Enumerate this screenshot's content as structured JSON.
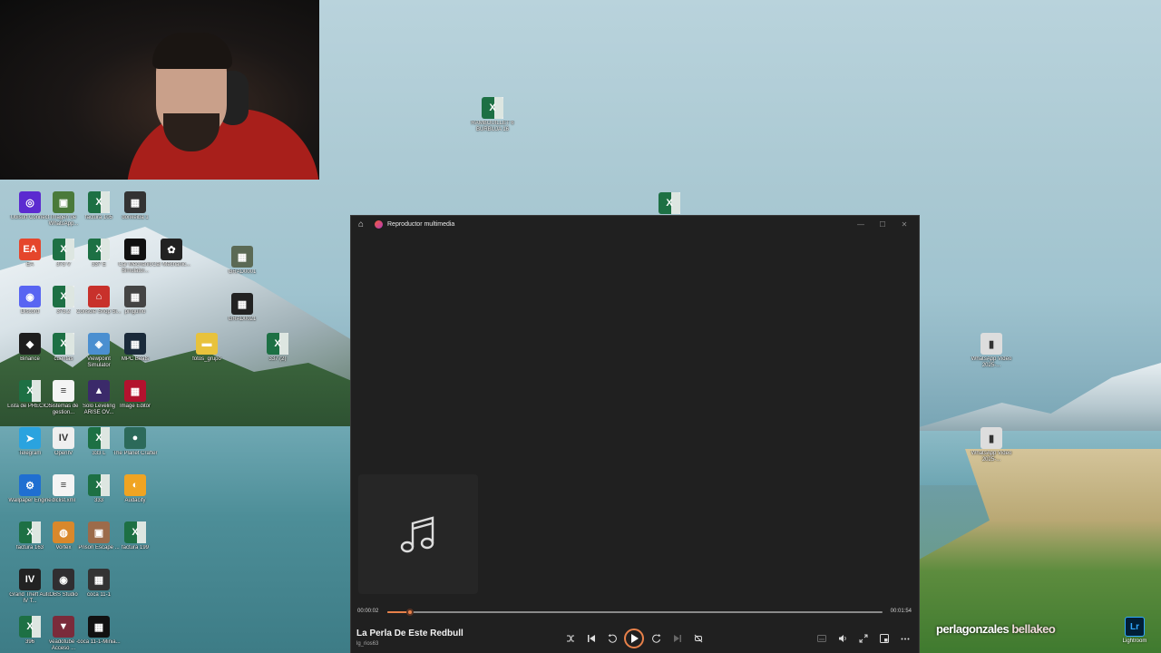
{
  "webcam": {
    "label": ""
  },
  "desktop": {
    "icons": [
      {
        "label": "Ubisoft Connect",
        "type": "app",
        "color": "#5b2bd0",
        "glyph": "◎"
      },
      {
        "label": "Imagen de WhatsApp...",
        "type": "img",
        "color": "#4a7a3a",
        "glyph": "▣"
      },
      {
        "label": "factura 105",
        "type": "xl"
      },
      {
        "label": "donkeiba 1",
        "type": "img",
        "color": "#333",
        "glyph": "▦"
      },
      {
        "label": "EA",
        "type": "app",
        "color": "#e5462c",
        "glyph": "EA"
      },
      {
        "label": "373 V",
        "type": "xl"
      },
      {
        "label": "337 E",
        "type": "xl"
      },
      {
        "label": "Car Mechanic Simulator...",
        "type": "img",
        "color": "#111",
        "glyph": "▦"
      },
      {
        "label": "Car Mechanic...",
        "type": "app",
        "color": "#222",
        "glyph": "✿"
      },
      {
        "label": "GRAD0001",
        "type": "img",
        "color": "#5b6a55",
        "glyph": "▦"
      },
      {
        "label": "Discord",
        "type": "app",
        "color": "#5865f2",
        "glyph": "◉"
      },
      {
        "label": "373.2",
        "type": "xl"
      },
      {
        "label": "Console Shop Si...",
        "type": "app",
        "color": "#c8312b",
        "glyph": "⌂"
      },
      {
        "label": "pinguino",
        "type": "img",
        "color": "#444",
        "glyph": "▦"
      },
      {
        "label": "GRAD0021",
        "type": "img",
        "color": "#222",
        "glyph": "▦"
      },
      {
        "label": "Binance",
        "type": "app",
        "color": "#1e1e1e",
        "glyph": "◆"
      },
      {
        "label": "cuentas",
        "type": "xl"
      },
      {
        "label": "Viewpoint Simulator",
        "type": "app",
        "color": "#4b8fd0",
        "glyph": "◈"
      },
      {
        "label": "MPC Beats",
        "type": "app",
        "color": "#1a2a3a",
        "glyph": "▦"
      },
      {
        "label": "fotos_grupo",
        "type": "folder",
        "color": "#e8c23c",
        "glyph": "▬"
      },
      {
        "label": "337 (2)",
        "type": "xl"
      },
      {
        "label": "Lista de PRECIOS",
        "type": "xl"
      },
      {
        "label": "Sistemas de gestion...",
        "type": "doc",
        "color": "#f4f4f4",
        "glyph": "≡"
      },
      {
        "label": "Solo Leveling ARISE OV...",
        "type": "app",
        "color": "#3b2a6a",
        "glyph": "▲"
      },
      {
        "label": "Image Editor",
        "type": "app",
        "color": "#b3122e",
        "glyph": "▦"
      },
      {
        "label": "Telegram",
        "type": "app",
        "color": "#2aa3df",
        "glyph": "➤"
      },
      {
        "label": "OpenIV",
        "type": "app",
        "color": "#efefef",
        "glyph": "IV"
      },
      {
        "label": "333 L",
        "type": "xl"
      },
      {
        "label": "The Planet Crafter",
        "type": "app",
        "color": "#2c6a5a",
        "glyph": "●"
      },
      {
        "label": "Wallpaper Engine",
        "type": "app",
        "color": "#1f6fd1",
        "glyph": "⚙"
      },
      {
        "label": "dlclist.xml",
        "type": "doc",
        "color": "#f4f4f4",
        "glyph": "≡"
      },
      {
        "label": "333",
        "type": "xl"
      },
      {
        "label": "Audacity",
        "type": "app",
        "color": "#f0a422",
        "glyph": "◐"
      },
      {
        "label": "factura 163",
        "type": "xl"
      },
      {
        "label": "Vortex",
        "type": "app",
        "color": "#d9882b",
        "glyph": "◍"
      },
      {
        "label": "Prison Escape ...",
        "type": "app",
        "color": "#9c6b4a",
        "glyph": "▣"
      },
      {
        "label": "factura 199",
        "type": "xl"
      },
      {
        "label": "Grand Theft Auto IV T...",
        "type": "app",
        "color": "#222",
        "glyph": "IV"
      },
      {
        "label": "OBS Studio",
        "type": "app",
        "color": "#302e31",
        "glyph": "◉"
      },
      {
        "label": "coca 11-1",
        "type": "img",
        "color": "#333",
        "glyph": "▦"
      },
      {
        "label": "396",
        "type": "xl"
      },
      {
        "label": "veadotube - Acceso ...",
        "type": "app",
        "color": "#7a2b3b",
        "glyph": "▼"
      },
      {
        "label": "coca 11-1-Minia...",
        "type": "img",
        "color": "#111",
        "glyph": "▦"
      },
      {
        "label": "RAMBOUILLET 6 BURBUJA 16",
        "type": "xl"
      },
      {
        "label": "",
        "type": "xl"
      },
      {
        "label": "WhatsApp Video 2025-...",
        "type": "img",
        "color": "#ddd",
        "glyph": "▮"
      },
      {
        "label": "WhatsApp Video 2025-...",
        "type": "img",
        "color": "#ddd",
        "glyph": "▮"
      }
    ]
  },
  "player": {
    "title": "Reproductor multimedia",
    "song_title": "La Perla De Este Redbull",
    "artist": "lg_rios63",
    "current_time": "00:00:02",
    "total_time": "00:01:54",
    "progress": 0.045,
    "accent": "#e8814a"
  },
  "watermark": {
    "part1": "perlagonzales",
    "part2": "bellakeo"
  },
  "lightroom": {
    "label": "Lightroom",
    "glyph": "Lr"
  }
}
